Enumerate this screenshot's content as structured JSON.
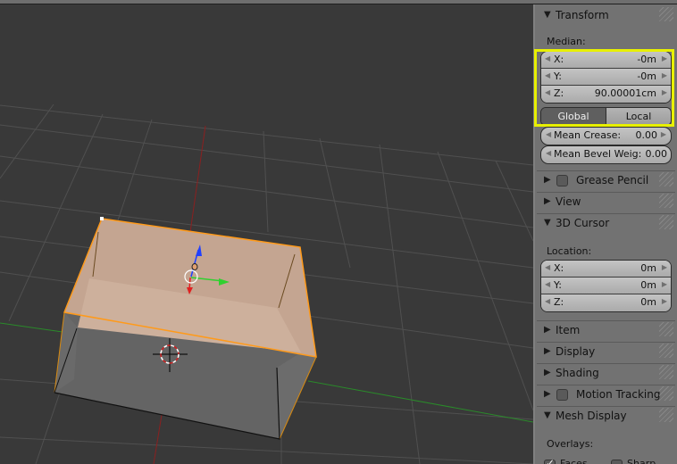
{
  "viewport": {
    "name": "3D Viewport",
    "selected_object": "Box mesh (top faces selected)"
  },
  "panel": {
    "transform": {
      "title": "Transform",
      "expanded": true,
      "median_label": "Median:",
      "fields": [
        {
          "key": "X:",
          "value": "-0m"
        },
        {
          "key": "Y:",
          "value": "-0m"
        },
        {
          "key": "Z:",
          "value": "90.00001cm"
        }
      ],
      "space_toggle": {
        "global": "Global",
        "local": "Local",
        "active": "Global"
      },
      "mean_crease": {
        "key": "Mean Crease:",
        "value": "0.00"
      },
      "mean_bevel": {
        "key": "Mean Bevel Weig:",
        "value": "0.00"
      }
    },
    "grease_pencil": {
      "title": "Grease Pencil",
      "expanded": false,
      "enabled": false
    },
    "view": {
      "title": "View",
      "expanded": false
    },
    "cursor": {
      "title": "3D Cursor",
      "expanded": true,
      "location_label": "Location:",
      "fields": [
        {
          "key": "X:",
          "value": "0m"
        },
        {
          "key": "Y:",
          "value": "0m"
        },
        {
          "key": "Z:",
          "value": "0m"
        }
      ]
    },
    "item": {
      "title": "Item",
      "expanded": false
    },
    "display": {
      "title": "Display",
      "expanded": false
    },
    "shading": {
      "title": "Shading",
      "expanded": false
    },
    "motion_tracking": {
      "title": "Motion Tracking",
      "expanded": false,
      "enabled": false
    },
    "mesh_display": {
      "title": "Mesh Display",
      "expanded": true,
      "overlays_label": "Overlays:",
      "faces": {
        "label": "Faces",
        "checked": true
      },
      "sharp": {
        "label": "Sharp",
        "checked": false
      }
    }
  },
  "colors": {
    "highlight": "#e8f000",
    "selection": "#ff9a1a",
    "x_axis": "#b02020",
    "y_axis": "#3aa03a"
  }
}
